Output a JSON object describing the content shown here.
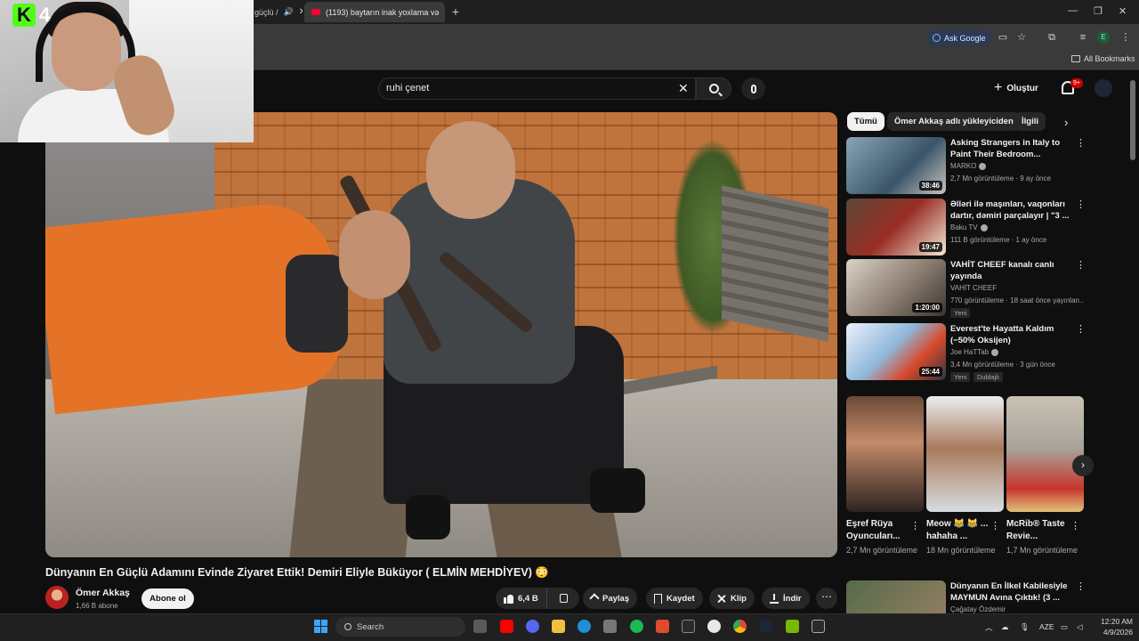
{
  "browser": {
    "tabs": [
      {
        "title": "güçlü /"
      },
      {
        "title": "(1193) baytarın inak yoxlama və"
      }
    ],
    "ask_google": "Ask Google",
    "profile_initial": "E",
    "all_bookmarks": "All Bookmarks"
  },
  "overlay": {
    "stream_number": "4"
  },
  "youtube": {
    "search_value": "ruhi çenet",
    "create_label": "Oluştur",
    "notification_count": "9+",
    "video": {
      "title": "Dünyanın En Güçlü Adamını Evinde Ziyaret Ettik! Demiri Eliyle Büküyor ( ELMİN MEHDİYEV) 😳",
      "channel": "Ömer Akkaş",
      "subscribers": "1,66 B abone",
      "subscribe_label": "Abone ol",
      "likes": "6,4 B",
      "share_label": "Paylaş",
      "save_label": "Kaydet",
      "clip_label": "Klip",
      "download_label": "İndir"
    },
    "chips": [
      "Tümü",
      "Ömer Akkaş adlı yükleyiciden",
      "İlgili"
    ],
    "recommendations": [
      {
        "title": "Asking Strangers in Italy to Paint Their Bedroom...",
        "channel": "MARKO",
        "meta": "2,7 Mn görüntüleme · 9 ay önce",
        "duration": "38:46"
      },
      {
        "title": "Əlləri ilə maşınları, vaqonları dartır, dəmiri parçalayır | \"3 ...",
        "channel": "Baku TV",
        "meta": "111 B görüntüleme · 1 ay önce",
        "duration": "19:47"
      },
      {
        "title": "VAHİT CHEEF kanalı canlı yayında",
        "channel": "VAHİT CHEEF",
        "meta": "770 görüntüleme · 18 saat önce yayınlan...",
        "duration": "1:20:00",
        "badge": "Yeni"
      },
      {
        "title": "Everest'te Hayatta Kaldım (−50% Oksijen)",
        "channel": "Joe HaTTab",
        "meta": "3,4 Mn görüntüleme · 3 gün önce",
        "duration": "25:44",
        "badge": "Yeni",
        "badge2": "Dublajlı"
      }
    ],
    "shorts": [
      {
        "title": "Eşref Rüya Oyuncuları...",
        "views": "2,7 Mn görüntüleme"
      },
      {
        "title": "Meow 😹 😹 ... hahaha ...",
        "views": "18 Mn görüntüleme"
      },
      {
        "title": "McRib® Taste Revie...",
        "views": "1,7 Mn görüntüleme"
      }
    ],
    "next_recommendation": {
      "title": "Dünyanın En İlkel Kabilesiyle MAYMUN Avına Çıktık! (3 ...",
      "channel": "Çağatay Özdemir"
    }
  },
  "taskbar": {
    "search_label": "Search",
    "language": "AZE",
    "time": "12:20 AM",
    "date": "4/9/2026"
  }
}
